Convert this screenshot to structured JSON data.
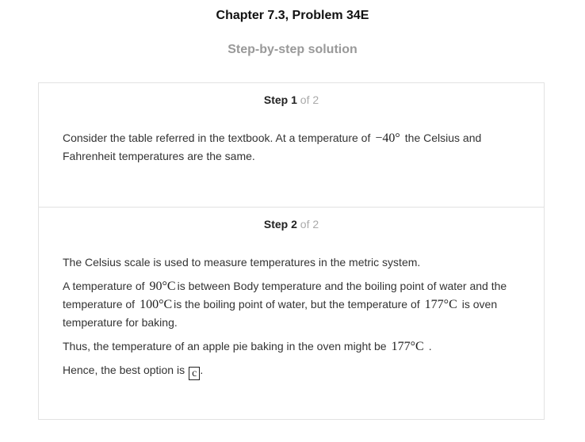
{
  "header": {
    "chapter_title": "Chapter 7.3, Problem 34E",
    "subtitle": "Step-by-step solution"
  },
  "steps": [
    {
      "label": "Step",
      "number": "1",
      "of_text": "of 2",
      "paragraphs": [
        {
          "before": "Consider the table referred in the textbook. At a temperature of",
          "math": "−40°",
          "after": "the Celsius and Fahrenheit temperatures are the same."
        }
      ]
    },
    {
      "label": "Step",
      "number": "2",
      "of_text": "of 2",
      "p1": "The Celsius scale is used to measure temperatures in the metric system.",
      "p2": {
        "t1": "A temperature of",
        "m1": "90°C",
        "t2": "is between Body temperature and the boiling point of water and the temperature of",
        "m2": "100°C",
        "t3": "is the boiling point of water, but the temperature of",
        "m3": "177°C",
        "t4": "is oven temperature for baking."
      },
      "p3": {
        "before": "Thus, the temperature of an apple pie baking in the oven might be",
        "math": "177°C",
        "after": "."
      },
      "p4": {
        "before": "Hence, the best option is",
        "answer": "c",
        "after": "."
      }
    }
  ]
}
